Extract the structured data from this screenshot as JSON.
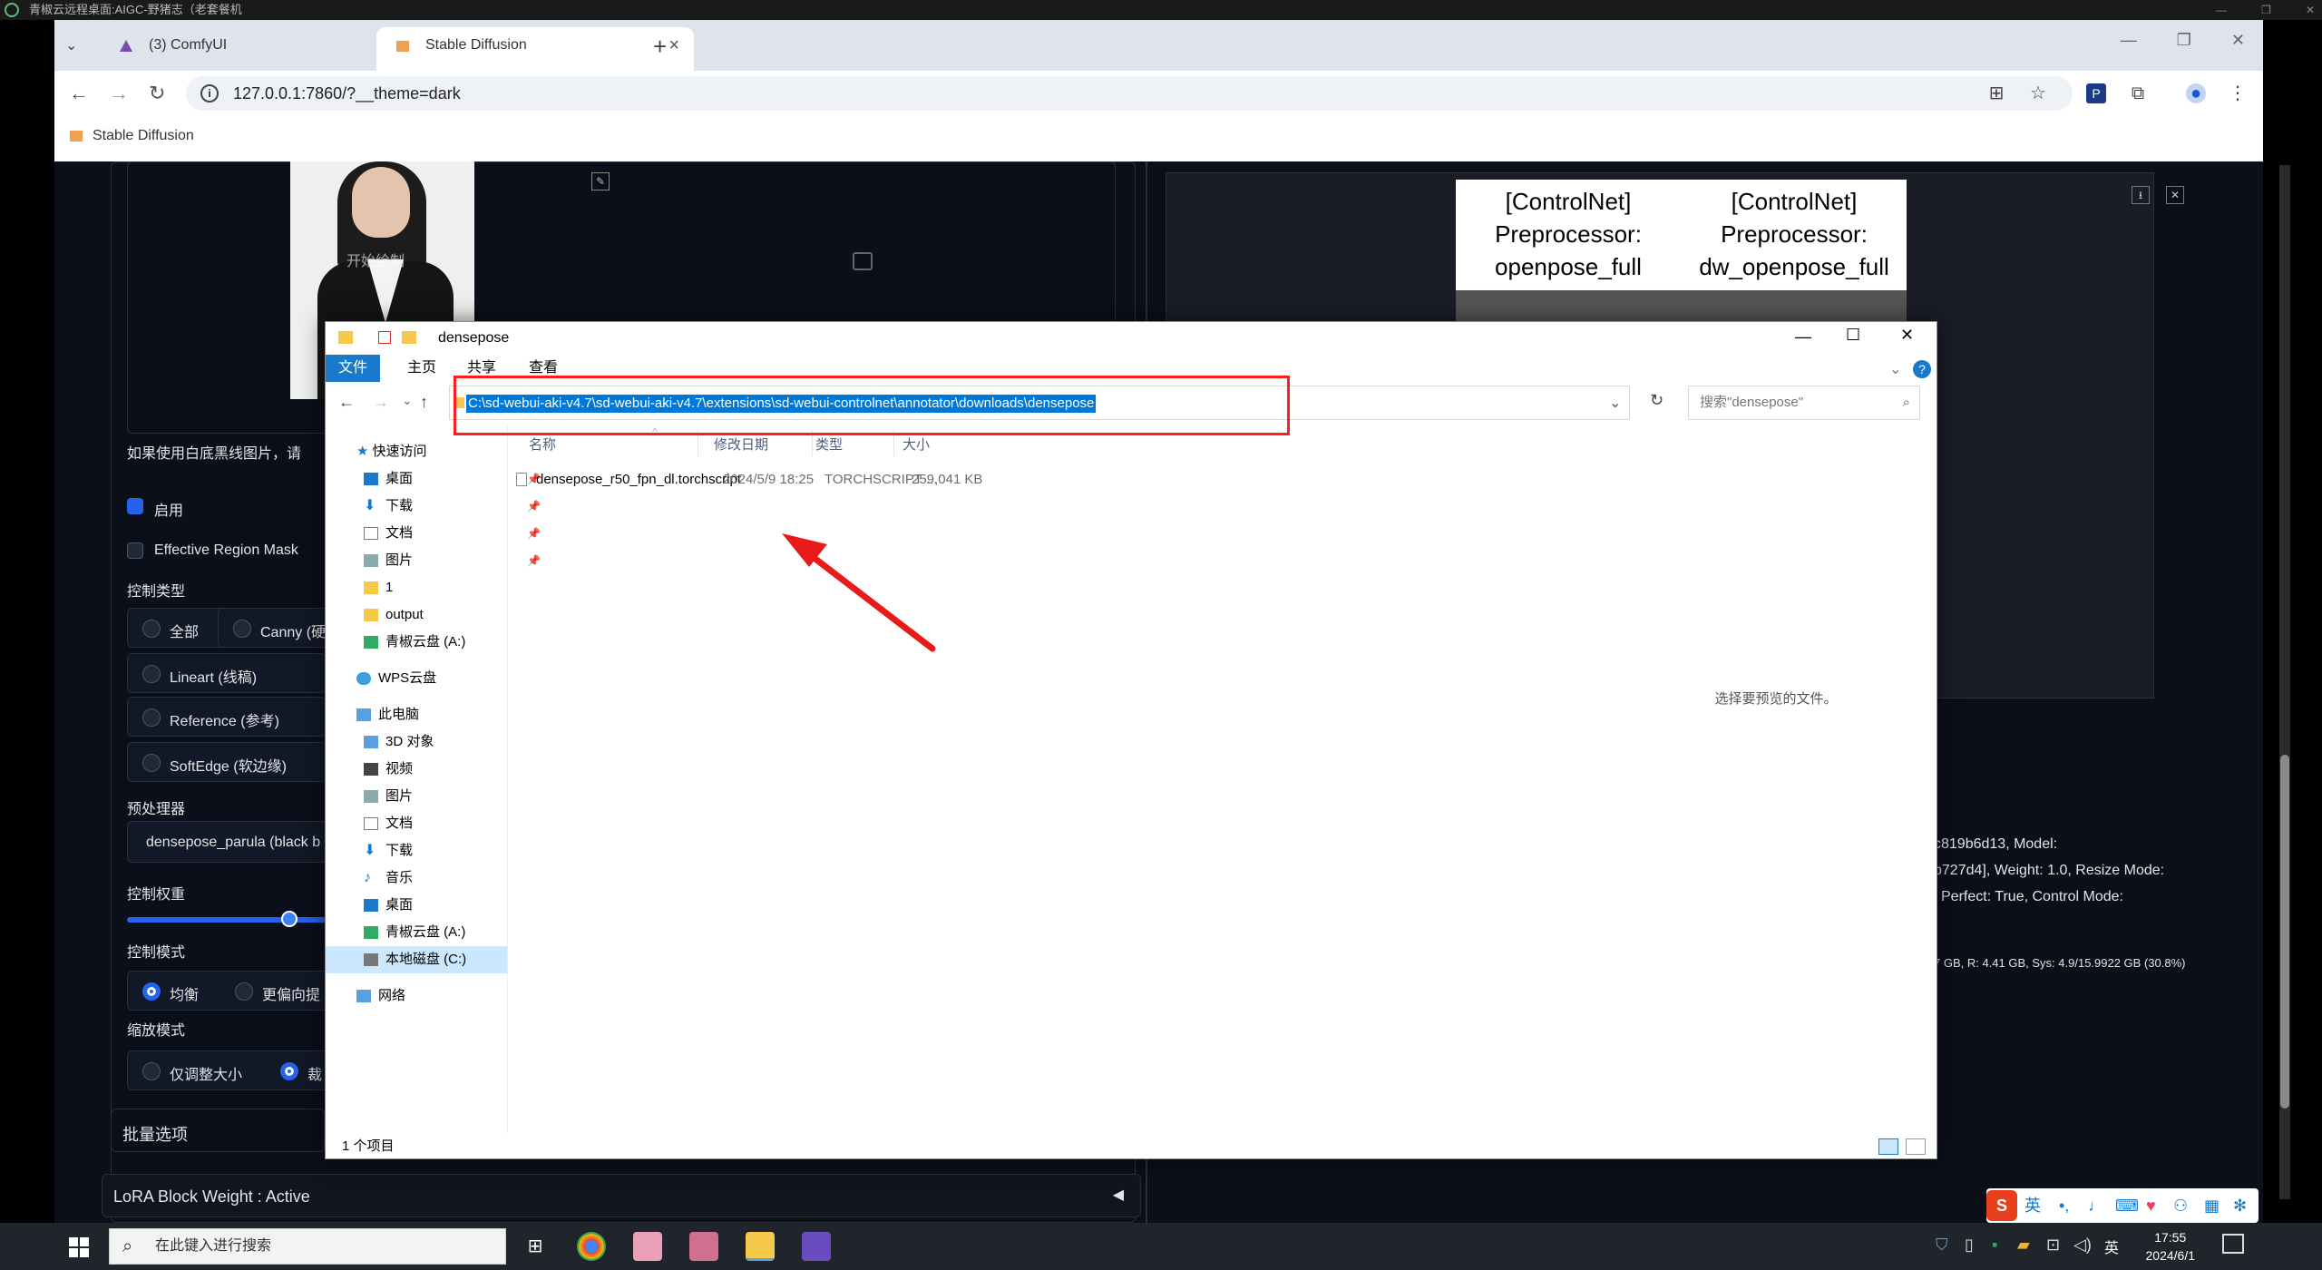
{
  "rdp": {
    "title": "青椒云远程桌面:AIGC-野猪志（老套餐机"
  },
  "browser": {
    "tabs": [
      {
        "label": "(3) ComfyUI"
      },
      {
        "label": "Stable Diffusion"
      }
    ],
    "url": "127.0.0.1:7860/?__theme=dark",
    "bookmark": "Stable Diffusion"
  },
  "sd_left": {
    "preview_overlay": "开始绘制",
    "hint": "如果使用白底黑线图片，请",
    "enable_label": "启用",
    "effective_region_mask": "Effective Region Mask",
    "control_type_label": "控制类型",
    "control_types": [
      "全部",
      "Canny (硬",
      "Lineart (线稿)",
      "Reference (参考)",
      "SoftEdge (软边缘)"
    ],
    "preprocessor_label": "预处理器",
    "preprocessor_value": "densepose_parula (black b",
    "weight_label": "控制权重",
    "mode_label": "控制模式",
    "mode_options": [
      "均衡",
      "更偏向提"
    ],
    "resize_label": "缩放模式",
    "resize_options": [
      "仅调整大小",
      "裁"
    ],
    "batch_label": "批量选项",
    "lora_label": "LoRA Block Weight : Active",
    "lora_arrow": "◀"
  },
  "sd_right": {
    "cn_captions": [
      "[ControlNet] Preprocessor: openpose_full",
      "[ControlNet] Preprocessor: dw_openpose_full"
    ],
    "info_lines": [
      "c819b6d13, Model:",
      "b727d4], Weight: 1.0, Resize Mode:",
      "l Perfect: True, Control Mode:"
    ],
    "mem_line": "7 GB, R: 4.41 GB, Sys: 4.9/15.9922 GB (30.8%)"
  },
  "explorer": {
    "title": "densepose",
    "ribbon": [
      "文件",
      "主页",
      "共享",
      "查看"
    ],
    "address": "C:\\sd-webui-aki-v4.7\\sd-webui-aki-v4.7\\extensions\\sd-webui-controlnet\\annotator\\downloads\\densepose",
    "search_placeholder": "搜索\"densepose\"",
    "nav": [
      {
        "label": "快速访问"
      },
      {
        "label": "桌面"
      },
      {
        "label": "下载"
      },
      {
        "label": "文档"
      },
      {
        "label": "图片"
      },
      {
        "label": "1"
      },
      {
        "label": "output"
      },
      {
        "label": "青椒云盘 (A:)"
      },
      {
        "label": "WPS云盘"
      },
      {
        "label": "此电脑"
      },
      {
        "label": "3D 对象"
      },
      {
        "label": "视频"
      },
      {
        "label": "图片"
      },
      {
        "label": "文档"
      },
      {
        "label": "下载"
      },
      {
        "label": "音乐"
      },
      {
        "label": "桌面"
      },
      {
        "label": "青椒云盘 (A:)"
      },
      {
        "label": "本地磁盘 (C:)"
      },
      {
        "label": "网络"
      }
    ],
    "columns": [
      "名称",
      "修改日期",
      "类型",
      "大小"
    ],
    "files": [
      {
        "name": "densepose_r50_fpn_dl.torchscript",
        "date": "2024/5/9 18:25",
        "type": "TORCHSCRIPT ...",
        "size": "259,041 KB"
      }
    ],
    "preview_text": "选择要预览的文件。",
    "status": "1 个项目"
  },
  "taskbar": {
    "search": "在此键入进行搜索",
    "time": "17:55",
    "date": "2024/6/1",
    "lang": "英"
  },
  "ime": {
    "lang": "英"
  }
}
